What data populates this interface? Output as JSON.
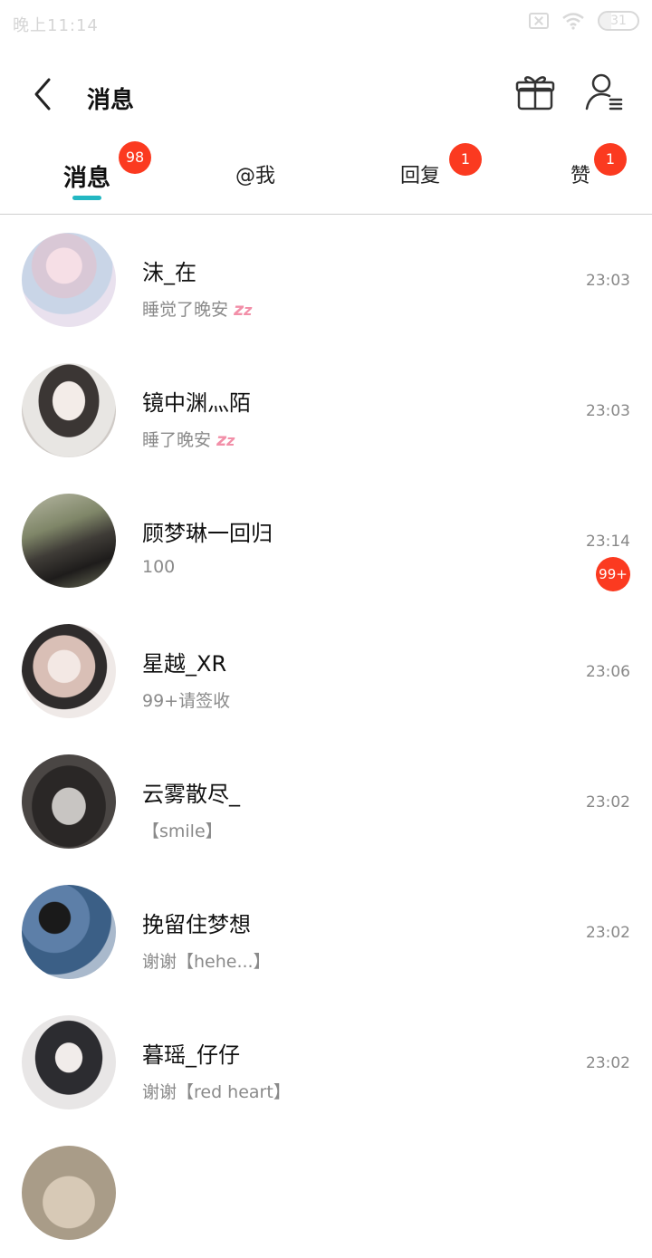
{
  "status": {
    "time": "晚上11:14",
    "battery": "31",
    "battery_level": 0.31
  },
  "header": {
    "title": "消息"
  },
  "tabs": [
    {
      "label": "消息",
      "badge": "98",
      "active": true
    },
    {
      "label": "@我",
      "badge": ""
    },
    {
      "label": "回复",
      "badge": "1"
    },
    {
      "label": "赞",
      "badge": "1"
    }
  ],
  "conversations": [
    {
      "name": "沫_在",
      "preview": "睡觉了晚安",
      "preview_icon": "zzz-sleep-icon",
      "time": "23:03",
      "badge": ""
    },
    {
      "name": "镜中渊灬陌",
      "preview": "睡了晚安",
      "preview_icon": "zzz-sleep-icon",
      "time": "23:03",
      "badge": ""
    },
    {
      "name": "顾梦琳一回归",
      "preview": "100",
      "time": "23:14",
      "badge": "99+"
    },
    {
      "name": "星越_XR",
      "preview": "99+请签收",
      "time": "23:06",
      "badge": ""
    },
    {
      "name": "云雾散尽_",
      "preview": "【smile】",
      "time": "23:02",
      "badge": ""
    },
    {
      "name": "挽留住梦想",
      "preview": "谢谢【hehe...】",
      "time": "23:02",
      "badge": ""
    },
    {
      "name": "暮瑶_仔仔",
      "preview": "谢谢【red heart】",
      "time": "23:02",
      "badge": ""
    }
  ],
  "colors": {
    "accent": "#23b7c2",
    "badge": "#fb3a20",
    "muted": "#8a8a8a",
    "zzz": "#f28fa8"
  }
}
